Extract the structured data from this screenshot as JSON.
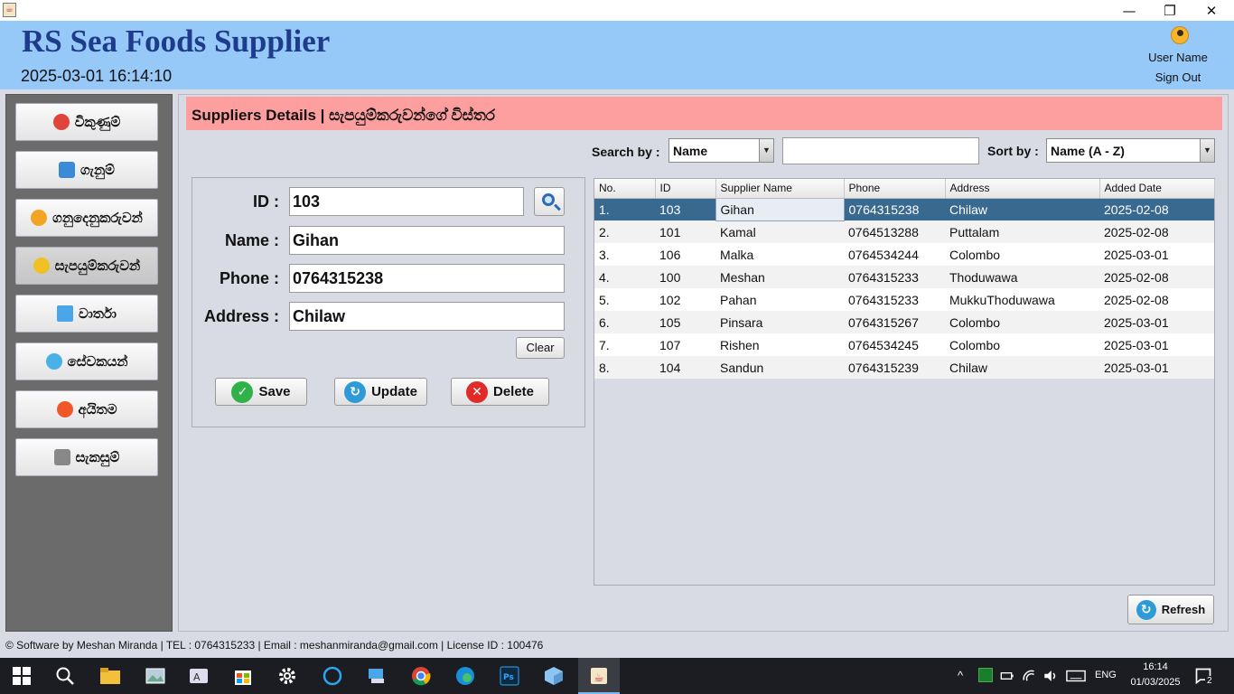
{
  "window": {
    "minimize": "—",
    "restore": "❐",
    "close": "✕"
  },
  "header": {
    "title": "RS Sea Foods Supplier",
    "datetime": "2025-03-01 16:14:10",
    "user_name": "User Name",
    "sign_out": "Sign Out"
  },
  "sidebar": {
    "items": [
      {
        "label": "විකුණුම්",
        "icon": "basket-icon",
        "color": "#e0443a"
      },
      {
        "label": "ගැනුම්",
        "icon": "cart-icon",
        "color": "#3a8ad8"
      },
      {
        "label": "ගනුදෙනුකරුවන්",
        "icon": "customer-icon",
        "color": "#f2a524"
      },
      {
        "label": "සැපයුම්කරුවන්",
        "icon": "supplier-icon",
        "color": "#f2c024"
      },
      {
        "label": "වාර්තා",
        "icon": "report-icon",
        "color": "#4aa6e8"
      },
      {
        "label": "සේවකයන්",
        "icon": "employee-icon",
        "color": "#4ab0e8"
      },
      {
        "label": "අයිතම",
        "icon": "fish-icon",
        "color": "#f0582a"
      },
      {
        "label": "සැකසුම්",
        "icon": "tools-icon",
        "color": "#888888"
      }
    ]
  },
  "main": {
    "heading": "Suppliers Details | සැපයුම්කරුවන්ගේ විස්තර",
    "search_by_label": "Search by :",
    "search_by_value": "Name",
    "search_text": "",
    "sort_by_label": "Sort by :",
    "sort_by_value": "Name (A - Z)"
  },
  "form": {
    "id_label": "ID :",
    "id_value": "103",
    "name_label": "Name :",
    "name_value": "Gihan",
    "phone_label": "Phone :",
    "phone_value": "0764315238",
    "address_label": "Address :",
    "address_value": "Chilaw",
    "clear": "Clear",
    "save": "Save",
    "update": "Update",
    "delete": "Delete"
  },
  "table": {
    "columns": [
      "No.",
      "ID",
      "Supplier Name",
      "Phone",
      "Address",
      "Added Date"
    ],
    "rows": [
      [
        "1.",
        "103",
        "Gihan",
        "0764315238",
        "Chilaw",
        "2025-02-08"
      ],
      [
        "2.",
        "101",
        "Kamal",
        "0764513288",
        "Puttalam",
        "2025-02-08"
      ],
      [
        "3.",
        "106",
        "Malka",
        "0764534244",
        "Colombo",
        "2025-03-01"
      ],
      [
        "4.",
        "100",
        "Meshan",
        "0764315233",
        "Thoduwawa",
        "2025-02-08"
      ],
      [
        "5.",
        "102",
        "Pahan",
        "0764315233",
        "MukkuThoduwawa",
        "2025-02-08"
      ],
      [
        "6.",
        "105",
        "Pinsara",
        "0764315267",
        "Colombo",
        "2025-03-01"
      ],
      [
        "7.",
        "107",
        "Rishen",
        "0764534245",
        "Colombo",
        "2025-03-01"
      ],
      [
        "8.",
        "104",
        "Sandun",
        "0764315239",
        "Chilaw",
        "2025-03-01"
      ]
    ],
    "selected_row": 0
  },
  "refresh": "Refresh",
  "footer": "© Software by Meshan Miranda  |  TEL : 0764315233  |  Email : meshanmiranda@gmail.com  |  License ID : 100476",
  "taskbar": {
    "language": "ENG",
    "time": "16:14",
    "date": "01/03/2025",
    "notifications": "2"
  }
}
